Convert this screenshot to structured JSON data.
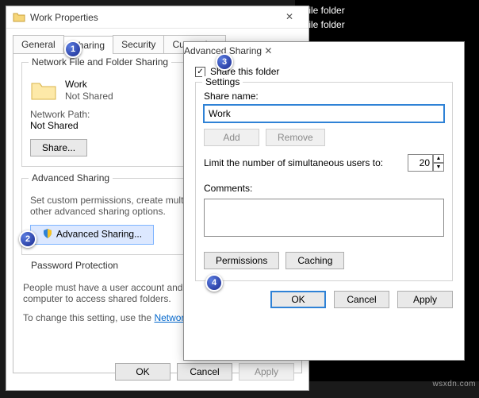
{
  "background": {
    "rows": [
      "File folder",
      "File folder"
    ]
  },
  "properties_window": {
    "title": "Work Properties",
    "tabs": {
      "general": "General",
      "sharing": "Sharing",
      "security": "Security",
      "customize": "Customize"
    },
    "network_group": {
      "legend": "Network File and Folder Sharing",
      "folder_name": "Work",
      "share_status": "Not Shared",
      "path_label": "Network Path:",
      "path_value": "Not Shared",
      "share_button": "Share..."
    },
    "advanced_group": {
      "legend": "Advanced Sharing",
      "desc": "Set custom permissions, create multiple shares, and set other advanced sharing options.",
      "button": "Advanced Sharing..."
    },
    "password_group": {
      "legend": "Password Protection",
      "line1": "People must have a user account and password for this computer to access shared folders.",
      "line2_prefix": "To change this setting, use the ",
      "link": "Network and Sharing Center."
    },
    "buttons": {
      "ok": "OK",
      "cancel": "Cancel",
      "apply": "Apply"
    }
  },
  "advanced_dialog": {
    "title": "Advanced Sharing",
    "share_checkbox": "Share this folder",
    "settings_legend": "Settings",
    "share_name_label": "Share name:",
    "share_name_value": "Work",
    "add": "Add",
    "remove": "Remove",
    "limit_label": "Limit the number of simultaneous users to:",
    "limit_value": "20",
    "comments_label": "Comments:",
    "comments_value": "",
    "permissions": "Permissions",
    "caching": "Caching",
    "ok": "OK",
    "cancel": "Cancel",
    "apply": "Apply"
  },
  "steps": {
    "s1": "1",
    "s2": "2",
    "s3": "3",
    "s4": "4"
  },
  "watermark": "wsxdn.com"
}
